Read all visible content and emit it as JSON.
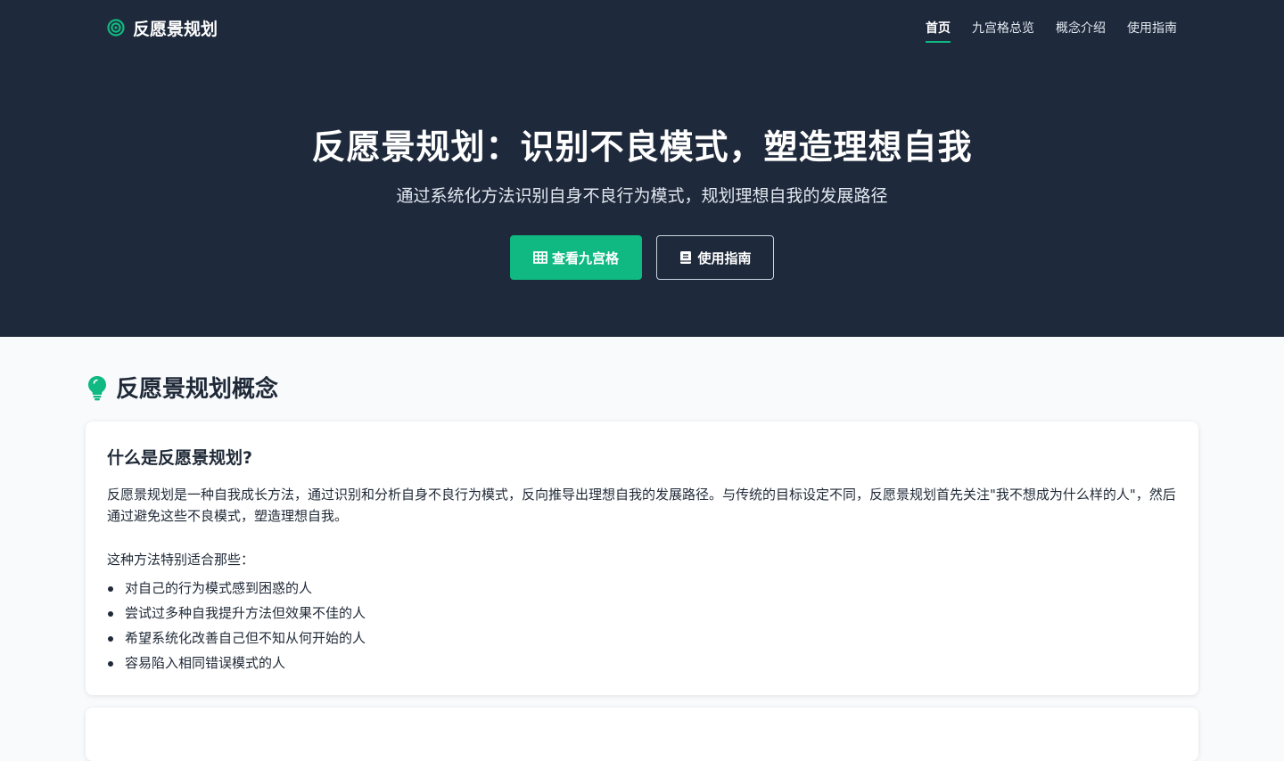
{
  "nav": {
    "brand": "反愿景规划",
    "links": [
      "首页",
      "九宫格总览",
      "概念介绍",
      "使用指南"
    ],
    "active_index": 0
  },
  "hero": {
    "title": "反愿景规划：识别不良模式，塑造理想自我",
    "subtitle": "通过系统化方法识别自身不良行为模式，规划理想自我的发展路径",
    "primary_button": "查看九宫格",
    "secondary_button": "使用指南"
  },
  "concept": {
    "heading": "反愿景规划概念",
    "card_title": "什么是反愿景规划?",
    "paragraph": "反愿景规划是一种自我成长方法，通过识别和分析自身不良行为模式，反向推导出理想自我的发展路径。与传统的目标设定不同，反愿景规划首先关注\"我不想成为什么样的人\"，然后通过避免这些不良模式，塑造理想自我。",
    "lead": "这种方法特别适合那些：",
    "items": [
      "对自己的行为模式感到困惑的人",
      "尝试过多种自我提升方法但效果不佳的人",
      "希望系统化改善自己但不知从何开始的人",
      "容易陷入相同错误模式的人"
    ]
  },
  "colors": {
    "hero_bg": "#1e293b",
    "accent": "#10b981",
    "page_bg": "#f8fafc"
  },
  "icons": {
    "brand": "target-icon",
    "primary_button": "grid-icon",
    "secondary_button": "book-icon",
    "heading": "lightbulb-icon"
  }
}
